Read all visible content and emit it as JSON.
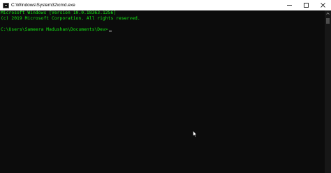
{
  "window": {
    "title": "C:\\Windows\\System32\\cmd.exe"
  },
  "titlebar_icons": {
    "app": "console-app-icon",
    "minimize": "minimize-icon",
    "maximize": "maximize-icon",
    "close": "close-icon"
  },
  "console": {
    "lines": [
      "Microsoft Windows [Version 10.0.18363.1256]",
      "(c) 2019 Microsoft Corporation. All rights reserved."
    ],
    "prompt": "C:\\Users\\Sameera Madushan\\Documents\\Dev>",
    "text_color": "#13e813",
    "background_color": "#0c0c0c"
  },
  "scrollbar": {
    "up_arrow": "scroll-up-arrow-icon"
  },
  "pointer": "mouse-pointer-icon"
}
